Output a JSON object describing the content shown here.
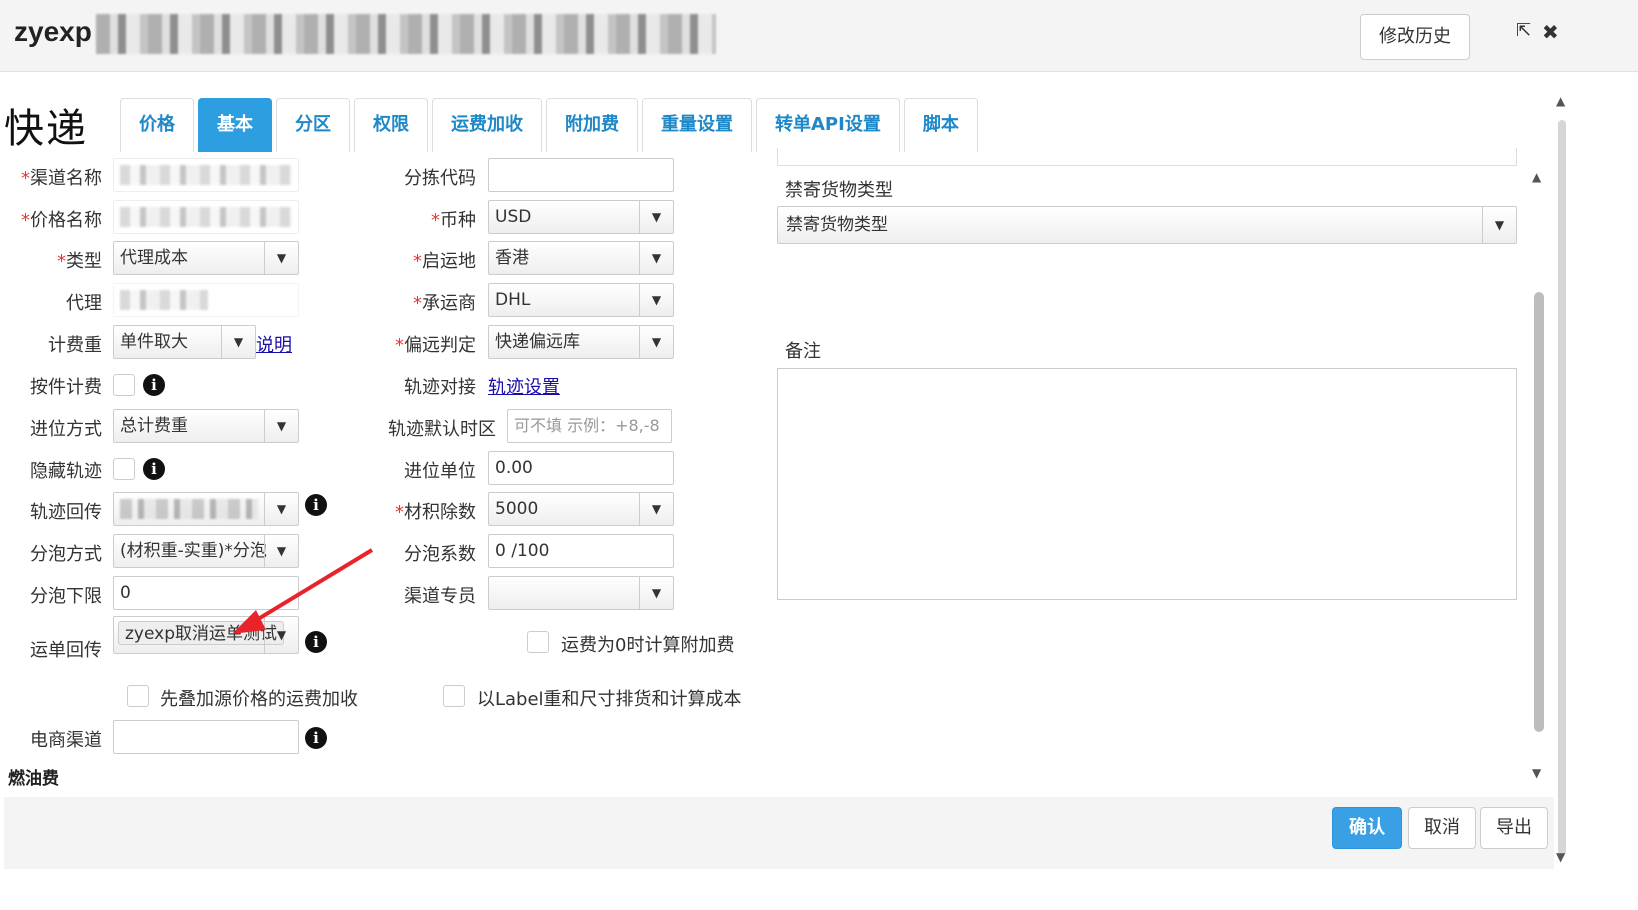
{
  "window": {
    "title": "zyexp",
    "history_button": "修改历史",
    "external_icon": "external-link-icon",
    "close_icon": "close-icon"
  },
  "page": {
    "heading": "快递"
  },
  "tabs": [
    {
      "label": "价格",
      "active": false
    },
    {
      "label": "基本",
      "active": true
    },
    {
      "label": "分区",
      "active": false
    },
    {
      "label": "权限",
      "active": false
    },
    {
      "label": "运费加收",
      "active": false
    },
    {
      "label": "附加费",
      "active": false
    },
    {
      "label": "重量设置",
      "active": false
    },
    {
      "label": "转单API设置",
      "active": false
    },
    {
      "label": "脚本",
      "active": false
    }
  ],
  "left_form": {
    "channel_name": {
      "label": "渠道名称",
      "required": true
    },
    "price_name": {
      "label": "价格名称",
      "required": true
    },
    "type": {
      "label": "类型",
      "required": true,
      "value": "代理成本"
    },
    "agent": {
      "label": "代理"
    },
    "billing_weight": {
      "label": "计费重",
      "value": "单件取大",
      "link": "说明"
    },
    "piece_billing": {
      "label": "按件计费"
    },
    "rounding_method": {
      "label": "进位方式",
      "value": "总计费重"
    },
    "hide_tracking": {
      "label": "隐藏轨迹"
    },
    "tracking_callback": {
      "label": "轨迹回传"
    },
    "split_method": {
      "label": "分泡方式",
      "value": "(材积重-实重)*分泡"
    },
    "split_lower_limit": {
      "label": "分泡下限",
      "value": "0"
    },
    "waybill_callback": {
      "label": "运单回传",
      "tag": "zyexp取消运单测试"
    },
    "stack_source_price": {
      "label": "先叠加源价格的运费加收"
    },
    "ecommerce_channel": {
      "label": "电商渠道"
    },
    "fuel_surcharge": {
      "label": "燃油费"
    }
  },
  "mid_form": {
    "sort_code": {
      "label": "分拣代码",
      "value": ""
    },
    "currency": {
      "label": "币种",
      "required": true,
      "value": "USD"
    },
    "origin": {
      "label": "启运地",
      "required": true,
      "value": "香港"
    },
    "carrier": {
      "label": "承运商",
      "required": true,
      "value": "DHL"
    },
    "remote_check": {
      "label": "偏远判定",
      "required": true,
      "value": "快递偏远库"
    },
    "tracking_link": {
      "label": "轨迹对接",
      "link": "轨迹设置"
    },
    "tracking_timezone": {
      "label": "轨迹默认时区",
      "placeholder": "可不填 示例：+8,-8"
    },
    "rounding_unit": {
      "label": "进位单位",
      "value": "0.00"
    },
    "volume_divisor": {
      "label": "材积除数",
      "required": true,
      "value": "5000"
    },
    "split_factor": {
      "label": "分泡系数",
      "value": "0 /100"
    },
    "channel_specialist": {
      "label": "渠道专员",
      "value": ""
    },
    "zero_freight_surcharge": {
      "label": "运费为0时计算附加费"
    },
    "label_weight_sort": {
      "label": "以Label重和尺寸排货和计算成本"
    }
  },
  "right_form": {
    "prohibited_goods": {
      "label": "禁寄货物类型",
      "value": "禁寄货物类型"
    },
    "remarks": {
      "label": "备注"
    }
  },
  "footer": {
    "confirm": "确认",
    "cancel": "取消",
    "export": "导出"
  },
  "colors": {
    "accent": "#2d9ee0",
    "required": "#ee3333",
    "annotation_arrow": "#e8242a"
  }
}
